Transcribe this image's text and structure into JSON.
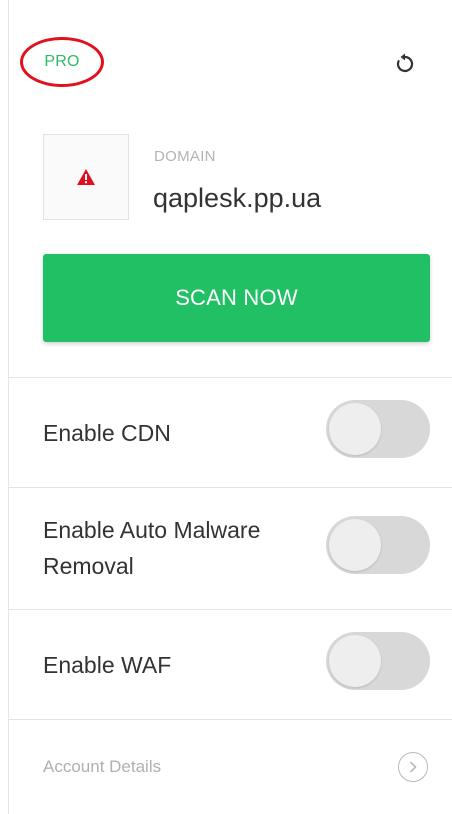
{
  "header": {
    "pro_badge": "PRO",
    "refresh_icon": "refresh-icon"
  },
  "site": {
    "favicon_icon": "warning-triangle-icon",
    "domain_label": "DOMAIN",
    "domain_name": "qaplesk.pp.ua"
  },
  "scan_button": {
    "label": "SCAN NOW"
  },
  "settings": [
    {
      "label": "Enable CDN",
      "enabled": false
    },
    {
      "label": "Enable Auto Malware Removal",
      "enabled": false
    },
    {
      "label": "Enable WAF",
      "enabled": false
    }
  ],
  "account": {
    "label": "Account Details",
    "icon": "chevron-right-circle-icon"
  },
  "colors": {
    "accent_green": "#22c065",
    "pro_text": "#2bbd64",
    "highlight_red": "#e3101e",
    "warning_red": "#e0101e",
    "toggle_off": "#d8d8d8"
  }
}
